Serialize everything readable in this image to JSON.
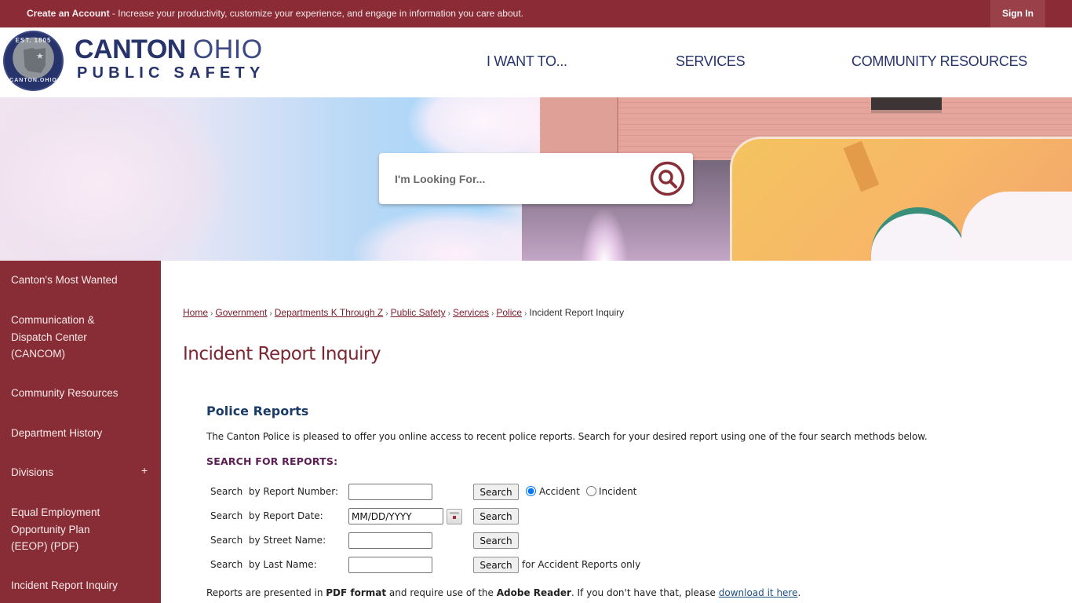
{
  "topbar": {
    "create_account_label": "Create an Account",
    "create_account_message": " - Increase your productivity, customize your experience, and engage in information you care about.",
    "sign_in_label": "Sign In"
  },
  "header": {
    "logo": {
      "seal_top_text": "EST. 1805",
      "seal_bottom_text": "CANTON.OHIO",
      "title_bold": "CANTON",
      "title_light": "OHIO",
      "subtitle": "PUBLIC SAFETY"
    },
    "nav": [
      {
        "label": "I WANT TO..."
      },
      {
        "label": "SERVICES"
      },
      {
        "label": "COMMUNITY RESOURCES"
      }
    ]
  },
  "hero": {
    "search_placeholder": "I'm Looking For...",
    "search_icon": "search-icon"
  },
  "sidebar": {
    "items": [
      {
        "label": "Canton's Most Wanted"
      },
      {
        "label": "Communication & Dispatch Center (CANCOM)"
      },
      {
        "label": "Community Resources"
      },
      {
        "label": "Department History"
      },
      {
        "label": "Divisions",
        "expand_icon": "+"
      },
      {
        "label": "Equal Employment Opportunity Plan (EEOP) (PDF)"
      },
      {
        "label": "Incident Report Inquiry"
      }
    ]
  },
  "breadcrumb": {
    "links": [
      "Home",
      "Government",
      "Departments K Through Z",
      "Public Safety",
      "Services",
      "Police"
    ],
    "current": "Incident Report Inquiry",
    "separator": "›"
  },
  "page": {
    "title": "Incident Report Inquiry",
    "section_heading": "Police Reports",
    "intro": "The Canton Police is pleased to offer you online access to recent police reports. Search for your desired report using one of the four search methods below.",
    "search_heading": "SEARCH FOR REPORTS:",
    "search_rows": [
      {
        "label": "Search  by Report Number:",
        "value": "",
        "button": "Search"
      },
      {
        "label": "Search  by Report Date:",
        "value": "MM/DD/YYYY",
        "button": "Search"
      },
      {
        "label": "Search  by Street Name:",
        "value": "",
        "button": "Search"
      },
      {
        "label": "Search  by Last Name:",
        "value": "",
        "button": "Search",
        "note": "for Accident Reports only"
      }
    ],
    "report_type": {
      "options": [
        "Accident",
        "Incident"
      ],
      "selected": "Accident"
    },
    "footnote": {
      "part1": "Reports are presented in ",
      "bold1": "PDF format",
      "part2": " and require use of the ",
      "bold2": "Adobe Reader",
      "part3": ". If you don't have that, please ",
      "link": "download it here",
      "part4": "."
    }
  },
  "colors": {
    "brand_maroon": "#882d35",
    "brand_navy": "#27336b",
    "heading_blue": "#1b3c66",
    "heading_purple": "#5c1d55"
  }
}
